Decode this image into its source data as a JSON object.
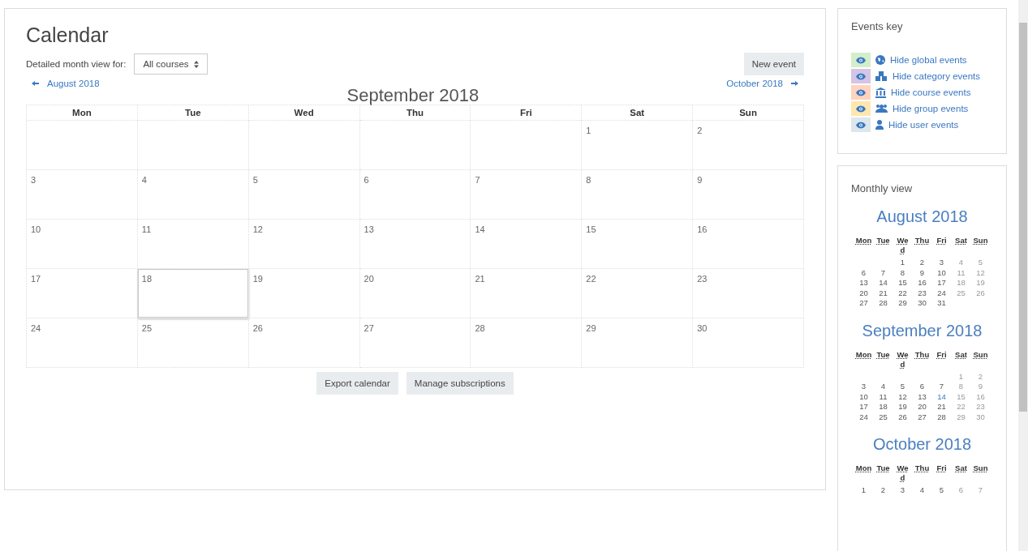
{
  "page_title": "Calendar",
  "filter": {
    "label": "Detailed month view for:",
    "value": "All courses"
  },
  "new_event_button": "New event",
  "navigation": {
    "previous": "August 2018",
    "current": "September 2018",
    "next": "October 2018"
  },
  "weekdays": [
    "Mon",
    "Tue",
    "Wed",
    "Thu",
    "Fri",
    "Sat",
    "Sun"
  ],
  "weeks": [
    [
      {
        "kind": "blank"
      },
      {
        "kind": "blank"
      },
      {
        "kind": "blank"
      },
      {
        "kind": "blank"
      },
      {
        "kind": "blank"
      },
      {
        "kind": "day",
        "day": "1",
        "selected": false
      },
      {
        "kind": "day",
        "day": "2",
        "selected": false
      }
    ],
    [
      {
        "kind": "day",
        "day": "3",
        "selected": false
      },
      {
        "kind": "day",
        "day": "4",
        "selected": false
      },
      {
        "kind": "day",
        "day": "5",
        "selected": false
      },
      {
        "kind": "day",
        "day": "6",
        "selected": false
      },
      {
        "kind": "day",
        "day": "7",
        "selected": false
      },
      {
        "kind": "day",
        "day": "8",
        "selected": false
      },
      {
        "kind": "day",
        "day": "9",
        "selected": false
      }
    ],
    [
      {
        "kind": "day",
        "day": "10",
        "selected": false
      },
      {
        "kind": "day",
        "day": "11",
        "selected": false
      },
      {
        "kind": "day",
        "day": "12",
        "selected": false
      },
      {
        "kind": "day",
        "day": "13",
        "selected": false
      },
      {
        "kind": "day",
        "day": "14",
        "selected": false
      },
      {
        "kind": "day",
        "day": "15",
        "selected": false
      },
      {
        "kind": "day",
        "day": "16",
        "selected": false
      }
    ],
    [
      {
        "kind": "day",
        "day": "17",
        "selected": false
      },
      {
        "kind": "day",
        "day": "18",
        "selected": true
      },
      {
        "kind": "day",
        "day": "19",
        "selected": false
      },
      {
        "kind": "day",
        "day": "20",
        "selected": false
      },
      {
        "kind": "day",
        "day": "21",
        "selected": false
      },
      {
        "kind": "day",
        "day": "22",
        "selected": false
      },
      {
        "kind": "day",
        "day": "23",
        "selected": false
      }
    ],
    [
      {
        "kind": "day",
        "day": "24",
        "selected": false
      },
      {
        "kind": "day",
        "day": "25",
        "selected": false
      },
      {
        "kind": "day",
        "day": "26",
        "selected": false
      },
      {
        "kind": "day",
        "day": "27",
        "selected": false
      },
      {
        "kind": "day",
        "day": "28",
        "selected": false
      },
      {
        "kind": "day",
        "day": "29",
        "selected": false
      },
      {
        "kind": "day",
        "day": "30",
        "selected": false
      }
    ]
  ],
  "footer_buttons": [
    "Export calendar",
    "Manage subscriptions"
  ],
  "events_key": {
    "title": "Events key",
    "items": [
      {
        "kind": "global",
        "label": "Hide global events",
        "color": "#d3efca"
      },
      {
        "kind": "category",
        "label": "Hide category events",
        "color": "#d6c4e4"
      },
      {
        "kind": "course",
        "label": "Hide course events",
        "color": "#ffd3bd"
      },
      {
        "kind": "group",
        "label": "Hide group events",
        "color": "#fee7ae"
      },
      {
        "kind": "user",
        "label": "Hide user events",
        "color": "#dce7ec"
      }
    ]
  },
  "monthly_view": {
    "title": "Monthly view",
    "months": [
      {
        "name": "August 2018",
        "weekdays": [
          "Mon",
          "Tue",
          "We d",
          "Thu",
          "Fri",
          "Sat",
          "Sun"
        ],
        "weeks": [
          [
            {
              "kind": "blank"
            },
            {
              "kind": "blank"
            },
            {
              "kind": "day",
              "d": "1",
              "today": false
            },
            {
              "kind": "day",
              "d": "2",
              "today": false
            },
            {
              "kind": "day",
              "d": "3",
              "today": false
            },
            {
              "kind": "day",
              "d": "4",
              "today": false
            },
            {
              "kind": "day",
              "d": "5",
              "today": false
            }
          ],
          [
            {
              "kind": "day",
              "d": "6",
              "today": false
            },
            {
              "kind": "day",
              "d": "7",
              "today": false
            },
            {
              "kind": "day",
              "d": "8",
              "today": false
            },
            {
              "kind": "day",
              "d": "9",
              "today": false
            },
            {
              "kind": "day",
              "d": "10",
              "today": false
            },
            {
              "kind": "day",
              "d": "11",
              "today": false
            },
            {
              "kind": "day",
              "d": "12",
              "today": false
            }
          ],
          [
            {
              "kind": "day",
              "d": "13",
              "today": false
            },
            {
              "kind": "day",
              "d": "14",
              "today": false
            },
            {
              "kind": "day",
              "d": "15",
              "today": false
            },
            {
              "kind": "day",
              "d": "16",
              "today": false
            },
            {
              "kind": "day",
              "d": "17",
              "today": false
            },
            {
              "kind": "day",
              "d": "18",
              "today": false
            },
            {
              "kind": "day",
              "d": "19",
              "today": false
            }
          ],
          [
            {
              "kind": "day",
              "d": "20",
              "today": false
            },
            {
              "kind": "day",
              "d": "21",
              "today": false
            },
            {
              "kind": "day",
              "d": "22",
              "today": false
            },
            {
              "kind": "day",
              "d": "23",
              "today": false
            },
            {
              "kind": "day",
              "d": "24",
              "today": false
            },
            {
              "kind": "day",
              "d": "25",
              "today": false
            },
            {
              "kind": "day",
              "d": "26",
              "today": false
            }
          ],
          [
            {
              "kind": "day",
              "d": "27",
              "today": false
            },
            {
              "kind": "day",
              "d": "28",
              "today": false
            },
            {
              "kind": "day",
              "d": "29",
              "today": false
            },
            {
              "kind": "day",
              "d": "30",
              "today": false
            },
            {
              "kind": "day",
              "d": "31",
              "today": false
            },
            {
              "kind": "blank"
            },
            {
              "kind": "blank"
            }
          ]
        ]
      },
      {
        "name": "September 2018",
        "weekdays": [
          "Mon",
          "Tue",
          "We d",
          "Thu",
          "Fri",
          "Sat",
          "Sun"
        ],
        "weeks": [
          [
            {
              "kind": "blank"
            },
            {
              "kind": "blank"
            },
            {
              "kind": "blank"
            },
            {
              "kind": "blank"
            },
            {
              "kind": "blank"
            },
            {
              "kind": "day",
              "d": "1",
              "today": false
            },
            {
              "kind": "day",
              "d": "2",
              "today": false
            }
          ],
          [
            {
              "kind": "day",
              "d": "3",
              "today": false
            },
            {
              "kind": "day",
              "d": "4",
              "today": false
            },
            {
              "kind": "day",
              "d": "5",
              "today": false
            },
            {
              "kind": "day",
              "d": "6",
              "today": false
            },
            {
              "kind": "day",
              "d": "7",
              "today": false
            },
            {
              "kind": "day",
              "d": "8",
              "today": false
            },
            {
              "kind": "day",
              "d": "9",
              "today": false
            }
          ],
          [
            {
              "kind": "day",
              "d": "10",
              "today": false
            },
            {
              "kind": "day",
              "d": "11",
              "today": false
            },
            {
              "kind": "day",
              "d": "12",
              "today": false
            },
            {
              "kind": "day",
              "d": "13",
              "today": false
            },
            {
              "kind": "day",
              "d": "14",
              "today": true
            },
            {
              "kind": "day",
              "d": "15",
              "today": false
            },
            {
              "kind": "day",
              "d": "16",
              "today": false
            }
          ],
          [
            {
              "kind": "day",
              "d": "17",
              "today": false
            },
            {
              "kind": "day",
              "d": "18",
              "today": false
            },
            {
              "kind": "day",
              "d": "19",
              "today": false
            },
            {
              "kind": "day",
              "d": "20",
              "today": false
            },
            {
              "kind": "day",
              "d": "21",
              "today": false
            },
            {
              "kind": "day",
              "d": "22",
              "today": false
            },
            {
              "kind": "day",
              "d": "23",
              "today": false
            }
          ],
          [
            {
              "kind": "day",
              "d": "24",
              "today": false
            },
            {
              "kind": "day",
              "d": "25",
              "today": false
            },
            {
              "kind": "day",
              "d": "26",
              "today": false
            },
            {
              "kind": "day",
              "d": "27",
              "today": false
            },
            {
              "kind": "day",
              "d": "28",
              "today": false
            },
            {
              "kind": "day",
              "d": "29",
              "today": false
            },
            {
              "kind": "day",
              "d": "30",
              "today": false
            }
          ]
        ]
      },
      {
        "name": "October 2018",
        "weekdays": [
          "Mon",
          "Tue",
          "We d",
          "Thu",
          "Fri",
          "Sat",
          "Sun"
        ],
        "weeks": [
          [
            {
              "kind": "day",
              "d": "1",
              "today": false
            },
            {
              "kind": "day",
              "d": "2",
              "today": false
            },
            {
              "kind": "day",
              "d": "3",
              "today": false
            },
            {
              "kind": "day",
              "d": "4",
              "today": false
            },
            {
              "kind": "day",
              "d": "5",
              "today": false
            },
            {
              "kind": "day",
              "d": "6",
              "today": false
            },
            {
              "kind": "day",
              "d": "7",
              "today": false
            }
          ]
        ]
      }
    ]
  }
}
